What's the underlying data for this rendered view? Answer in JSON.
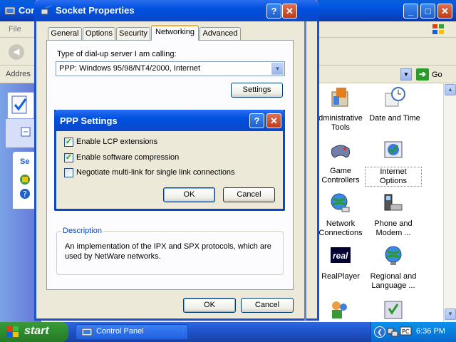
{
  "control_panel": {
    "title": "Con",
    "menu_file": "File",
    "address_label": "Addres",
    "go_label": "Go",
    "items": [
      {
        "label": "dministrative\nTools",
        "icon": "administrative-tools-icon"
      },
      {
        "label": "Date and Time",
        "icon": "clock-icon"
      },
      {
        "label": "Game\nControllers",
        "icon": "gamepad-icon"
      },
      {
        "label": "Internet\nOptions",
        "icon": "internet-options-icon"
      },
      {
        "label": "Network\nConnections",
        "icon": "network-globe-icon"
      },
      {
        "label": "Phone and\nModem ...",
        "icon": "phone-modem-icon"
      },
      {
        "label": "RealPlayer",
        "icon": "realplayer-icon"
      },
      {
        "label": "Regional and\nLanguage ...",
        "icon": "regional-globe-icon"
      }
    ],
    "left_pane_fragment": "Se"
  },
  "socket_properties": {
    "title": "Socket Properties",
    "tabs": [
      "General",
      "Options",
      "Security",
      "Networking",
      "Advanced"
    ],
    "active_tab": "Networking",
    "server_type_label": "Type of dial-up server I am calling:",
    "server_type_value": "PPP: Windows 95/98/NT4/2000, Internet",
    "settings_button": "Settings",
    "description_legend": "Description",
    "description_text": "An implementation of the IPX and SPX protocols, which are used by NetWare networks.",
    "ok_button": "OK",
    "cancel_button": "Cancel"
  },
  "ppp_settings": {
    "title": "PPP Settings",
    "options": [
      {
        "label": "Enable LCP extensions",
        "checked": true
      },
      {
        "label": "Enable software compression",
        "checked": true
      },
      {
        "label": "Negotiate multi-link for single link connections",
        "checked": false
      }
    ],
    "ok_button": "OK",
    "cancel_button": "Cancel"
  },
  "taskbar": {
    "start_label": "start",
    "task_control_panel": "Control Panel",
    "clock": "6:36 PM"
  },
  "colors": {
    "title_blue": "#0050e0",
    "dialog_face": "#ece9d8",
    "start_green": "#2e8f2e",
    "link_blue": "#0046d5"
  }
}
